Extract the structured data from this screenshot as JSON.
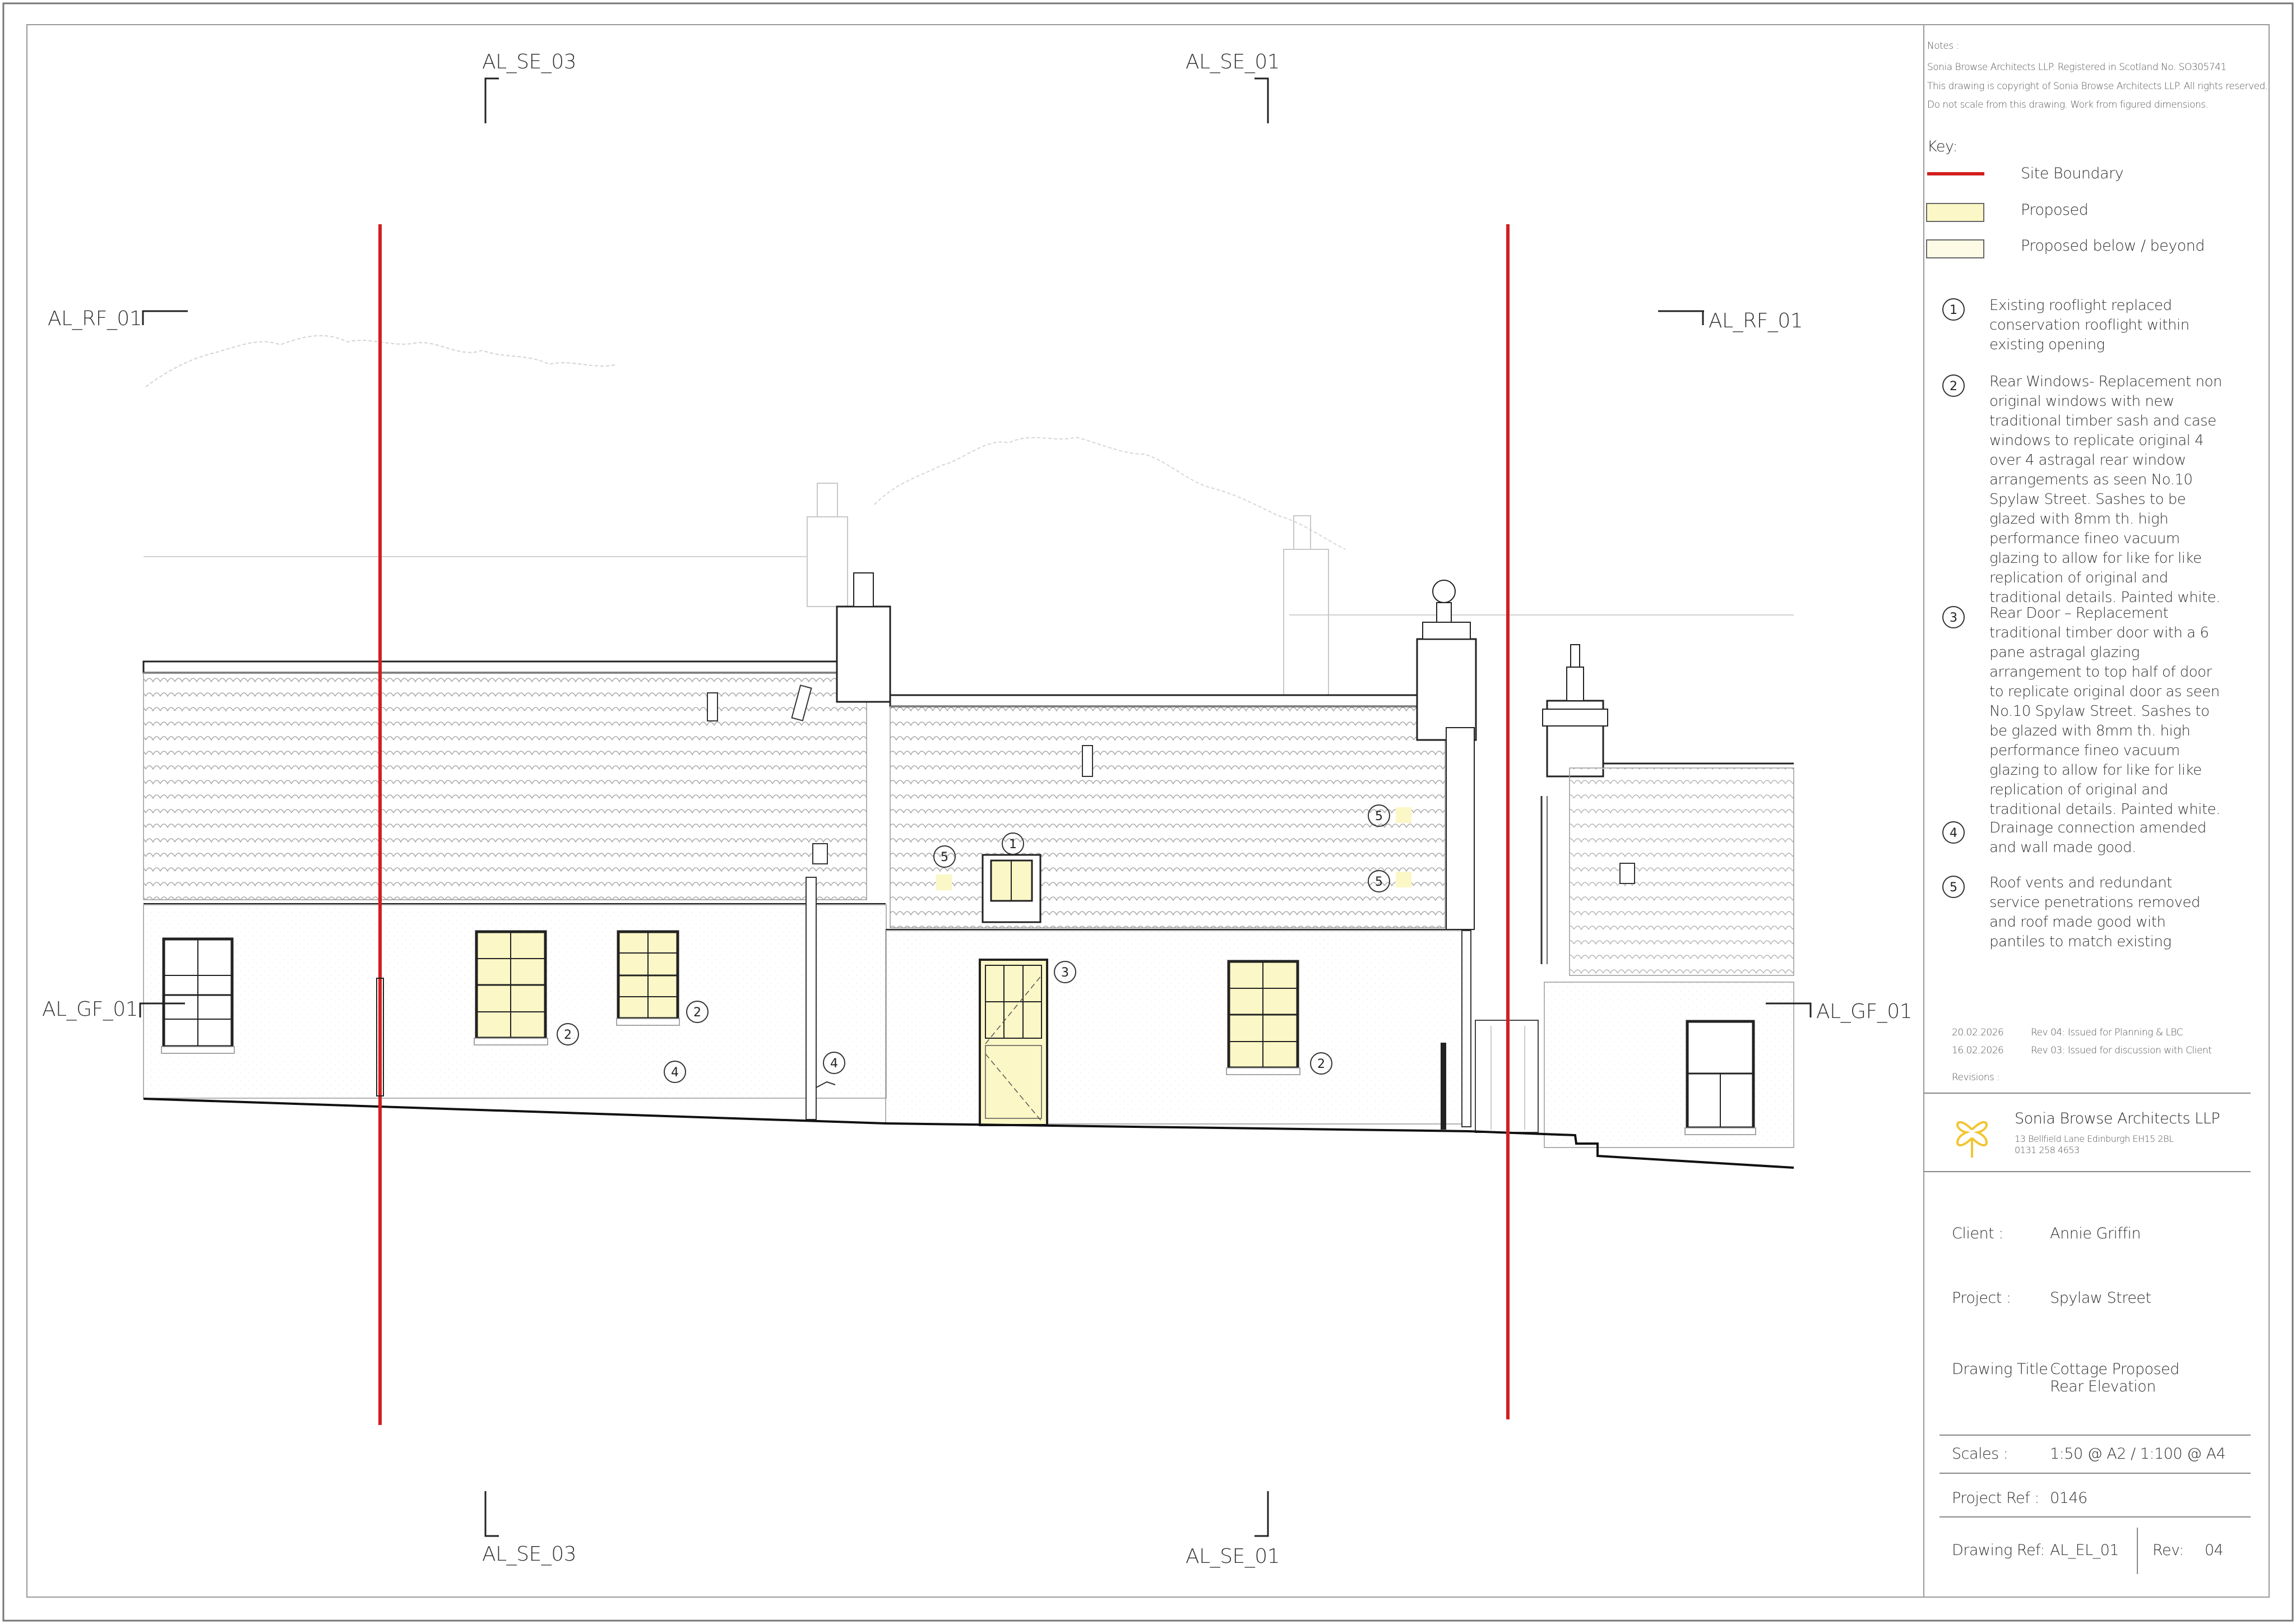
{
  "section_marks": {
    "top_left": "AL_SE_03",
    "top_right": "AL_SE_01",
    "bottom_left": "AL_SE_03",
    "bottom_right": "AL_SE_01",
    "rf_left": "AL_RF_01",
    "rf_right": "AL_RF_01",
    "gf_left": "AL_GF_01",
    "gf_right": "AL_GF_01"
  },
  "notes": {
    "heading": "Notes :",
    "lines": [
      "Sonia Browse Architects LLP. Registered in Scotland No. SO305741",
      "This drawing is copyright of Sonia Browse Architects LLP. All rights reserved.",
      "Do not scale from this drawing. Work from figured dimensions."
    ]
  },
  "key": {
    "heading": "Key:",
    "items": [
      {
        "label": "Site Boundary",
        "color": "#d21f1f"
      },
      {
        "label": "Proposed",
        "color": "#fbf7c6"
      },
      {
        "label": "Proposed below / beyond",
        "color": "#fdfbe6"
      }
    ]
  },
  "annotations": [
    {
      "num": "1",
      "text": "Existing rooflight replaced conservation rooflight within existing opening"
    },
    {
      "num": "2",
      "text": "Rear Windows- Replacement non original windows with new traditional timber sash and case windows to replicate original 4 over 4 astragal rear window arrangements as seen No.10 Spylaw Street.  Sashes to be glazed with 8mm th. high performance fineo vacuum glazing to allow for like for like replication of original and traditional details. Painted white."
    },
    {
      "num": "3",
      "text": "Rear Door – Replacement traditional timber door with a 6 pane astragal glazing arrangement to top half of door to replicate original door as seen No.10 Spylaw Street. Sashes to be glazed with 8mm th. high performance fineo vacuum glazing to allow for like for like replication of original and traditional details. Painted white."
    },
    {
      "num": "4",
      "text": "Drainage connection amended and wall made good."
    },
    {
      "num": "5",
      "text": "Roof vents and redundant service penetrations removed and roof made good with pantiles to match existing"
    }
  ],
  "revisions": {
    "heading": "Revisions :",
    "rows": [
      {
        "date": "20.02.2026",
        "desc": "Rev 04: Issued for Planning & LBC"
      },
      {
        "date": "16.02.2026",
        "desc": "Rev 03: Issued for discussion with Client"
      }
    ]
  },
  "practice": {
    "name": "Sonia Browse Architects LLP",
    "address": "13 Bellfield Lane Edinburgh EH15 2BL",
    "phone": "0131 258 4653",
    "logo_color": "#f2c531"
  },
  "title_block": {
    "client_label": "Client :",
    "client": "Annie Griffin",
    "project_label": "Project :",
    "project": "Spylaw Street",
    "drawing_title_label": "Drawing Title :",
    "drawing_title_line1": "Cottage Proposed",
    "drawing_title_line2": "Rear Elevation",
    "scales_label": "Scales :",
    "scales": "1:50 @ A2 / 1:100 @ A4",
    "project_ref_label": "Project Ref :",
    "project_ref": "0146",
    "drawing_ref_label": "Drawing Ref:",
    "drawing_ref": "AL_EL_01",
    "rev_label": "Rev:",
    "rev": "04"
  },
  "markers": {
    "m1": "1",
    "m2a": "2",
    "m2b": "2",
    "m2c": "2",
    "m3": "3",
    "m4a": "4",
    "m4b": "4",
    "m5a": "5",
    "m5b": "5",
    "m5c": "5"
  },
  "colors": {
    "boundary": "#d21f1f",
    "proposed": "#fbf7c6",
    "line": "#222222"
  }
}
